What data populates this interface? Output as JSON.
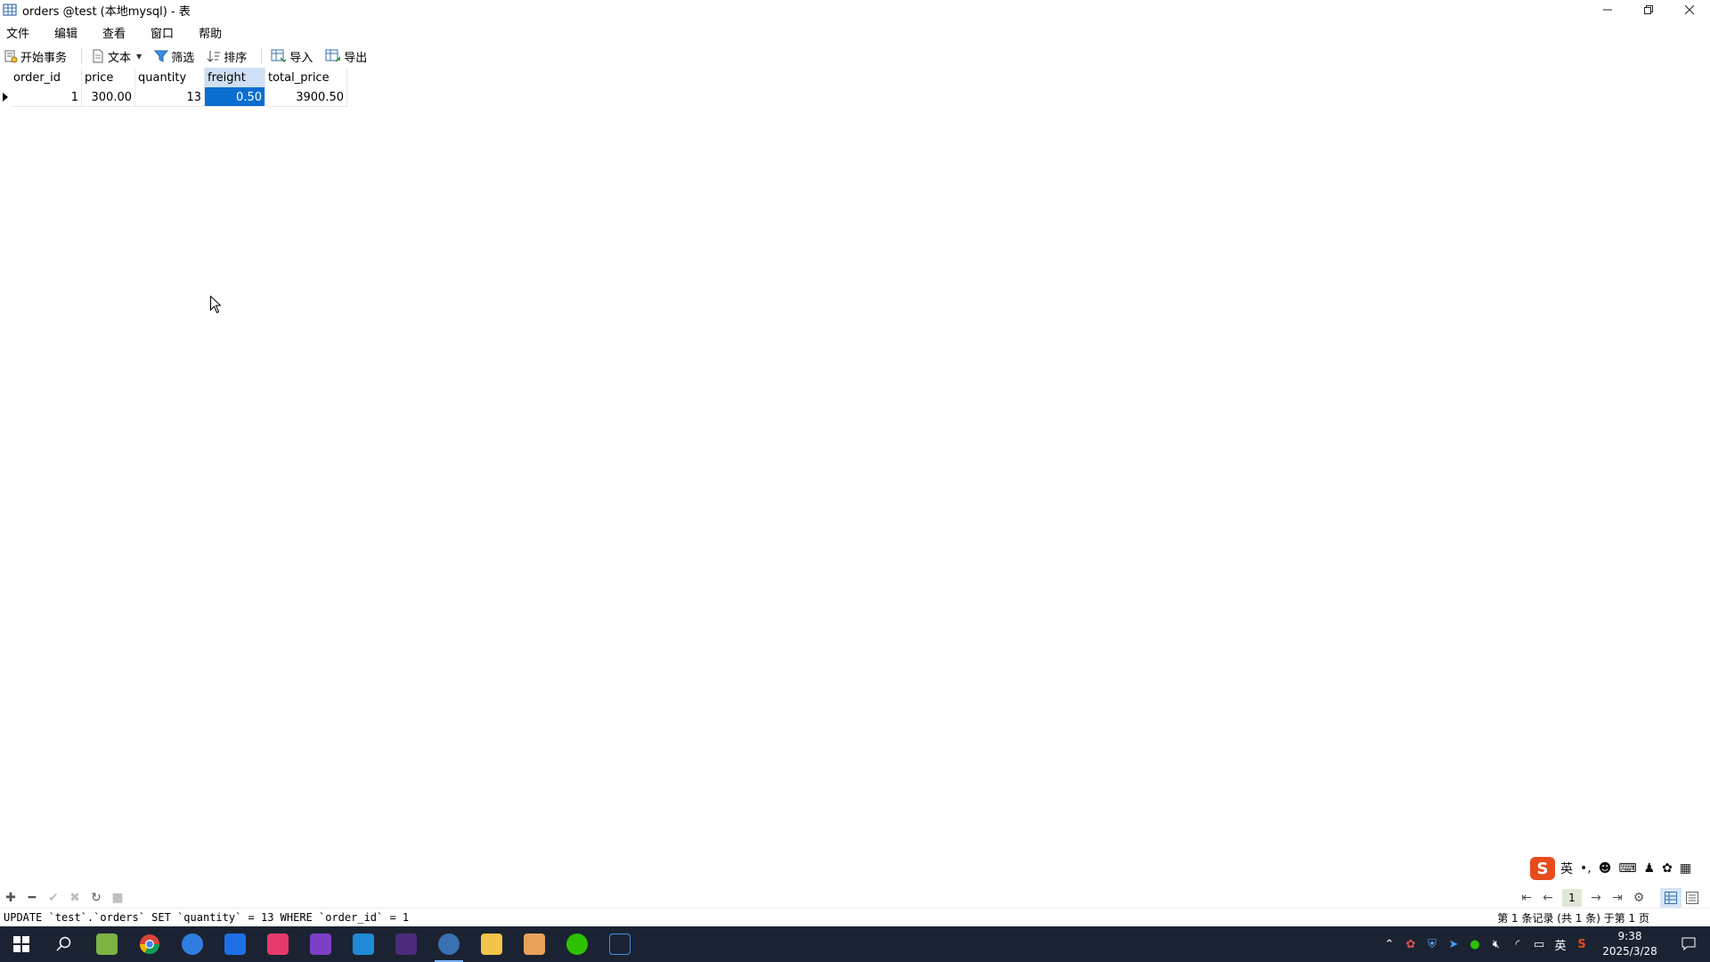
{
  "window": {
    "title": "orders @test (本地mysql) - 表",
    "controls": [
      "minimize",
      "restore",
      "close"
    ]
  },
  "menu": {
    "items": [
      "文件",
      "编辑",
      "查看",
      "窗口",
      "帮助"
    ]
  },
  "toolbar": {
    "begin_transaction": "开始事务",
    "text": "文本",
    "filter": "筛选",
    "sort": "排序",
    "import": "导入",
    "export": "导出"
  },
  "table": {
    "columns": [
      "order_id",
      "price",
      "quantity",
      "freight",
      "total_price"
    ],
    "selected_column": "freight",
    "rows": [
      {
        "order_id": "1",
        "price": "300.00",
        "quantity": "13",
        "freight": "0.50",
        "total_price": "3900.50"
      }
    ]
  },
  "ime": {
    "logo": "S",
    "mode": "英",
    "punct": "•,"
  },
  "pager": {
    "current_page": "1"
  },
  "status": {
    "sql": "UPDATE `test`.`orders` SET `quantity` = 13 WHERE `order_id` = 1",
    "record_info": "第 1 条记录 (共 1 条) 于第 1 页"
  },
  "taskbar": {
    "time": "9:38",
    "date": "2025/3/28",
    "ime_lang": "英"
  },
  "colors": {
    "selected_cell": "#0a6ed1",
    "selected_header": "#cfe0f5",
    "taskbar_bg": "#1b2333"
  }
}
